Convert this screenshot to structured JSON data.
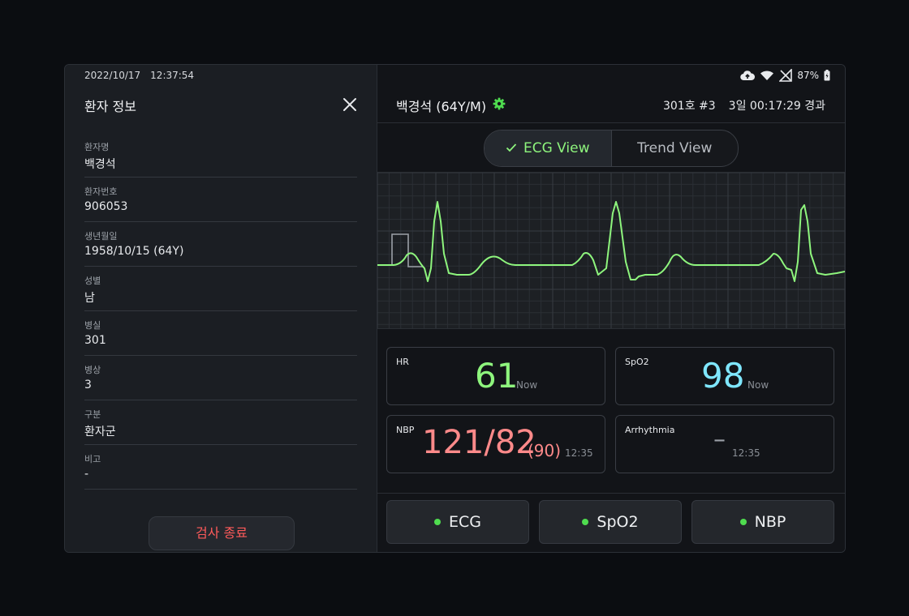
{
  "left_panel": {
    "date": "2022/10/17",
    "time": "12:37:54",
    "title": "환자 정보",
    "fields": [
      {
        "label": "환자명",
        "value": "백경석"
      },
      {
        "label": "환자번호",
        "value": "906053"
      },
      {
        "label": "생년월일",
        "value": "1958/10/15 (64Y)"
      },
      {
        "label": "성별",
        "value": "남"
      },
      {
        "label": "병실",
        "value": "301"
      },
      {
        "label": "병상",
        "value": "3"
      },
      {
        "label": "구분",
        "value": "환자군"
      },
      {
        "label": "비고",
        "value": "-"
      }
    ],
    "end_button": "검사 종료"
  },
  "status_bar": {
    "battery": "87%",
    "icons": [
      "cloud-upload-icon",
      "wifi-icon",
      "no-signal-icon",
      "battery-icon"
    ]
  },
  "header": {
    "patient": "백경석 (64Y/M)",
    "room": "301호 #3",
    "elapsed": "3일 00:17:29 경과"
  },
  "view_toggle": {
    "active": "ECG View",
    "inactive": "Trend View"
  },
  "vitals": {
    "hr": {
      "label": "HR",
      "value": "61",
      "sub": "Now",
      "color": "#8ef57d"
    },
    "spo2": {
      "label": "SpO2",
      "value": "98",
      "sub": "Now",
      "color": "#7fe7ff"
    },
    "nbp": {
      "label": "NBP",
      "value": "121/82",
      "mean": "(90)",
      "sub": "12:35",
      "color": "#ff8a8a"
    },
    "arrhythmia": {
      "label": "Arrhythmia",
      "value": "–",
      "sub": "12:35",
      "color": "#9ba0a7"
    }
  },
  "param_buttons": [
    "ECG",
    "SpO2",
    "NBP"
  ],
  "colors": {
    "ecg_trace": "#8ef57d",
    "status_dot": "#4fdc4f",
    "end_button_text": "#ff5a5a"
  }
}
